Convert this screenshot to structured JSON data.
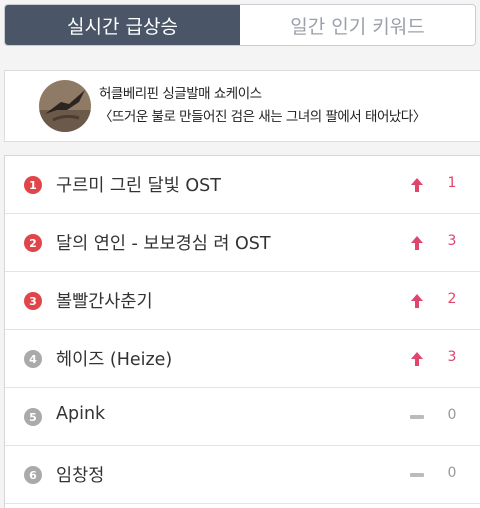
{
  "tabs": [
    {
      "label": "실시간 급상승",
      "active": true
    },
    {
      "label": "일간 인기 키워드",
      "active": false
    }
  ],
  "banner": {
    "line1": "허클베리핀 싱글발매 쇼케이스",
    "line2": "〈뜨거운 불로 만들어진 검은 새는 그녀의 팔에서 태어났다〉"
  },
  "colors": {
    "top_rank": "#e0454a",
    "other_rank": "#aaaaaa",
    "up": "#e0456d",
    "same": "#bbbbbb",
    "tab_active_bg": "#4a5568"
  },
  "items": [
    {
      "rank": "1",
      "title": "구르미 그린 달빛 OST",
      "trend": "up",
      "change": "1"
    },
    {
      "rank": "2",
      "title": "달의 연인 - 보보경심 려 OST",
      "trend": "up",
      "change": "3"
    },
    {
      "rank": "3",
      "title": "볼빨간사춘기",
      "trend": "up",
      "change": "2"
    },
    {
      "rank": "4",
      "title": "헤이즈 (Heize)",
      "trend": "up",
      "change": "3"
    },
    {
      "rank": "5",
      "title": "Apink",
      "trend": "same",
      "change": "0"
    },
    {
      "rank": "6",
      "title": "임창정",
      "trend": "same",
      "change": "0"
    }
  ]
}
